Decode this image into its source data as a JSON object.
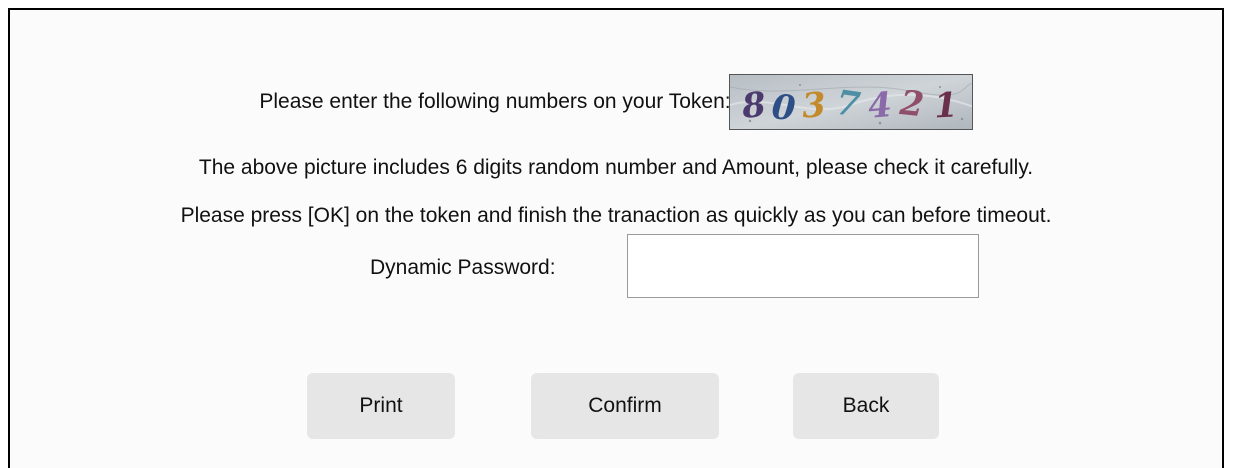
{
  "token_prompt": "Please enter the following numbers on your Token:",
  "captcha": {
    "digits": [
      "8",
      "0",
      "3",
      "7",
      "4",
      "2",
      "1"
    ],
    "colors": [
      "#4b3a6e",
      "#2e4f86",
      "#c28a2a",
      "#4f8fa6",
      "#8a6aa8",
      "#8f4f6a",
      "#6a2f4a"
    ]
  },
  "info_line_1": "The above picture includes 6 digits random number and Amount, please check it carefully.",
  "info_line_2": "Please press [OK] on the token and finish the tranaction as quickly as you can before timeout.",
  "password": {
    "label": "Dynamic Password:",
    "value": ""
  },
  "buttons": {
    "print": "Print",
    "confirm": "Confirm",
    "back": "Back"
  }
}
